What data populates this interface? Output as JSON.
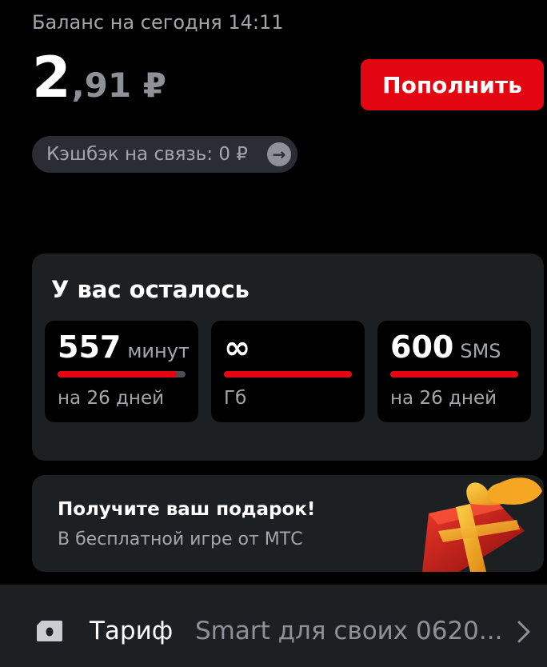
{
  "balance": {
    "caption": "Баланс на сегодня 14:11",
    "integer": "2",
    "fraction": ",91 ₽",
    "topup_label": "Пополнить"
  },
  "cashback": {
    "label": "Кэшбэк на связь: 0 ₽",
    "arrow_icon": "arrow-right-icon",
    "arrow_glyph": "→"
  },
  "remaining": {
    "title": "У вас осталось",
    "tiles": [
      {
        "value": "557",
        "unit": "минут",
        "subtitle": "на 26 дней",
        "progress": 0.93
      },
      {
        "value": "∞",
        "unit": "",
        "subtitle": "Гб",
        "progress": 1.0
      },
      {
        "value": "600",
        "unit": "SMS",
        "subtitle": "на 26 дней",
        "progress": 1.0
      }
    ]
  },
  "promo": {
    "title": "Получите ваш подарок!",
    "subtitle": "В бесплатной игре от МТС",
    "image_icon": "gift-box-icon"
  },
  "tariff": {
    "label": "Тариф",
    "value": "Smart для своих 0620...",
    "icon": "sim-card-icon",
    "chevron_icon": "chevron-right-icon"
  },
  "colors": {
    "accent": "#e30611",
    "card_bg": "#1d2023",
    "muted_text": "#a3a6ac"
  }
}
